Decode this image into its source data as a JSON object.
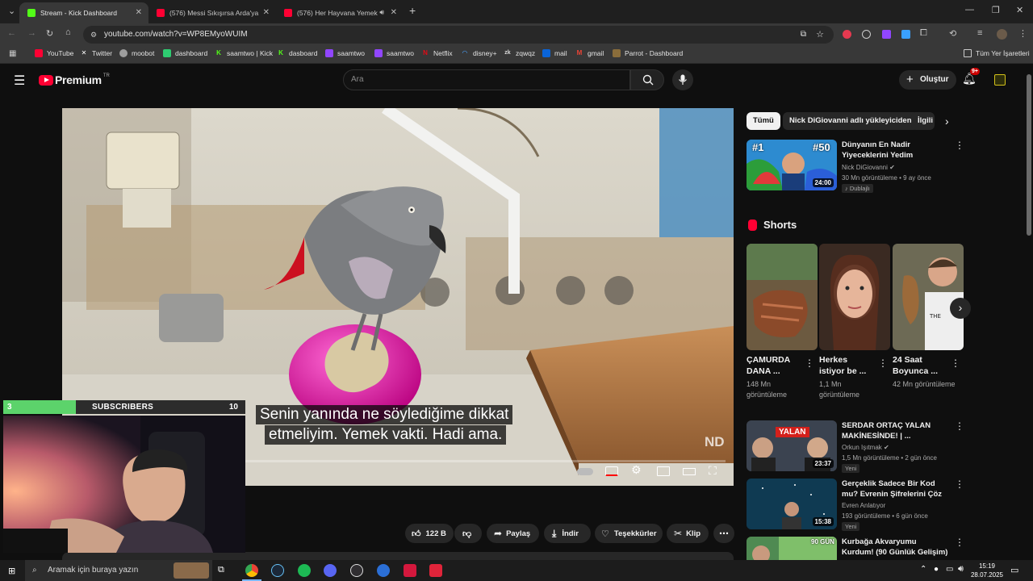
{
  "browser": {
    "tabs": [
      {
        "title": "Stream - Kick Dashboard",
        "fav_color": "#53fc18"
      },
      {
        "title": "(576) Messi Sıkışırsa Arda'ya Oy",
        "fav_color": "#ff0033"
      },
      {
        "title": "(576) Her Hayvana Yemek",
        "fav_color": "#ff0033"
      }
    ],
    "url": "youtube.com/watch?v=WP8EMyoWUIM",
    "bookmarks": [
      {
        "label": "YouTube",
        "icon": "youtube-icon",
        "color": "#ff0033"
      },
      {
        "label": "Twitter",
        "icon": "x-icon",
        "color": "#ffffff"
      },
      {
        "label": "moobot",
        "icon": "moobot-icon",
        "color": "#9e9e9e"
      },
      {
        "label": "dashboard",
        "icon": "dashboard-icon",
        "color": "#2ecc71"
      },
      {
        "label": "saamtwo | Kick",
        "icon": "kick-icon",
        "color": "#53fc18"
      },
      {
        "label": "dasboard",
        "icon": "kick-icon",
        "color": "#53fc18"
      },
      {
        "label": "saamtwo",
        "icon": "twitch-icon",
        "color": "#9146ff"
      },
      {
        "label": "saamtwo",
        "icon": "twitch-icon",
        "color": "#9146ff"
      },
      {
        "label": "Netflix",
        "icon": "netflix-icon",
        "color": "#e50914"
      },
      {
        "label": "disney+",
        "icon": "disney-icon",
        "color": "#4aa3ff"
      },
      {
        "label": "zqwqz",
        "icon": "zk-icon",
        "color": "#555555"
      },
      {
        "label": "mail",
        "icon": "outlook-icon",
        "color": "#0a64d8"
      },
      {
        "label": "gmail",
        "icon": "gmail-icon",
        "color": "#ea4335"
      },
      {
        "label": "Parrot - Dashboard",
        "icon": "parrot-icon",
        "color": "#8a6d3b"
      }
    ],
    "all_bookmarks": "Tüm Yer İşaretleri"
  },
  "youtube": {
    "logo_text": "Premium",
    "region": "TR",
    "search_placeholder": "Ara",
    "create_label": "Oluştur",
    "notification_count": "9+"
  },
  "video": {
    "caption_line1": "Senin yanında ne söylediğime dikkat",
    "caption_line2": "etmeliyim. Yemek vakti. Hadi ama.",
    "watermark": "ND"
  },
  "actions": {
    "likes": "122 B",
    "share": "Paylaş",
    "download": "İndir",
    "thanks": "Teşekkürler",
    "clip": "Klip"
  },
  "sidebar": {
    "chips": [
      "Tümü",
      "Nick DiGiovanni adlı yükleyiciden",
      "İlgili"
    ],
    "first_video": {
      "title": "Dünyanın En Nadir Yiyeceklerini Yedim",
      "channel": "Nick DiGiovanni",
      "meta": "30 Mn görüntüleme • 9 ay önce",
      "badge": "Dublajlı",
      "duration": "24:00",
      "thumb_text1": "#1",
      "thumb_text2": "#50"
    },
    "shorts_heading": "Shorts",
    "shorts": [
      {
        "title": "ÇAMURDA DANA ...",
        "views": "148 Mn görüntüleme"
      },
      {
        "title": "Herkes istiyor be ...",
        "views": "1,1 Mn görüntüleme"
      },
      {
        "title": "24 Saat Boyunca ...",
        "views": "42 Mn görüntüleme"
      }
    ],
    "videos": [
      {
        "title": "SERDAR ORTAÇ YALAN MAKİNESİNDE! | ...",
        "channel": "Orkun Işıtmak",
        "meta": "1,5 Mn görüntüleme • 2 gün önce",
        "badge": "Yeni",
        "duration": "23:37",
        "thumb_text": "YALAN"
      },
      {
        "title": "Gerçeklik Sadece Bir Kod mu? Evrenin Şifrelerini Çöz",
        "channel": "Evren Anlatıyor",
        "meta": "193 görüntüleme • 6 gün önce",
        "badge": "Yeni",
        "duration": "15:38"
      },
      {
        "title": "Kurbağa Akvaryumu Kurdum! (90 Günlük Gelişim)",
        "thumb_text": "90 GÜN"
      }
    ]
  },
  "overlay": {
    "left_count": "3",
    "label": "SUBSCRIBERS",
    "right_count": "10",
    "progress": 0.3
  },
  "taskbar": {
    "search_placeholder": "Aramak için buraya yazın",
    "time": "15:19",
    "date": "28.07.2025"
  }
}
